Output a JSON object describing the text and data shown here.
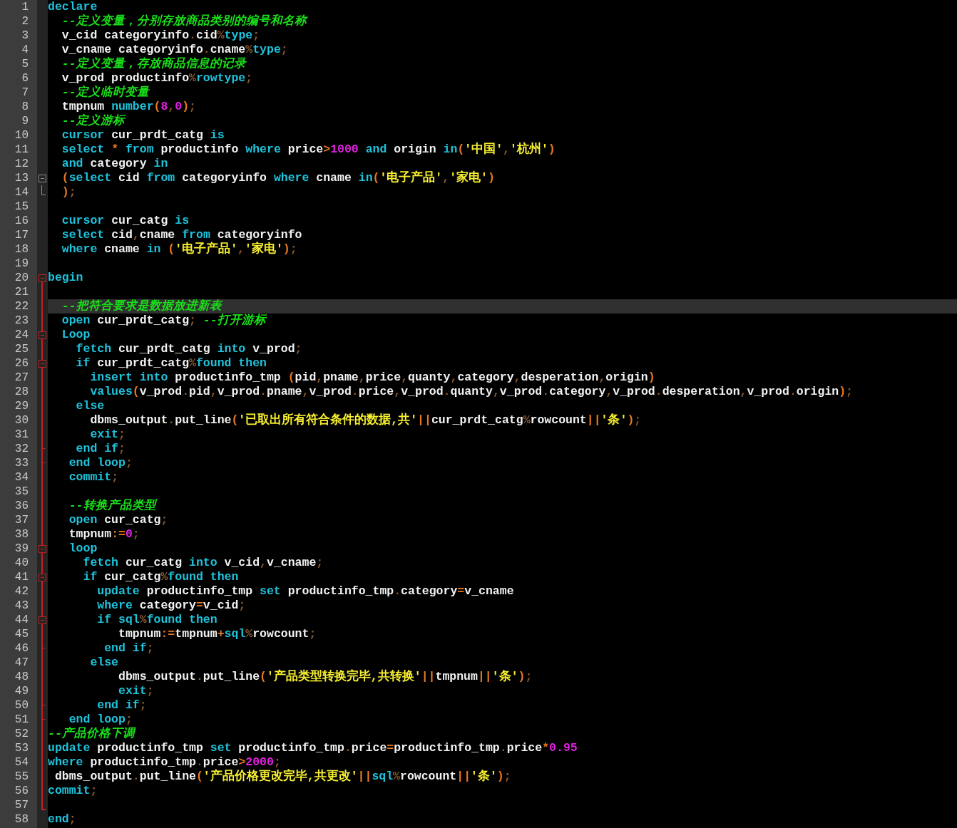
{
  "editor": {
    "lines": [
      {
        "number": "1",
        "selected": false,
        "tokens": [
          {
            "kind": "kw",
            "text": "declare"
          }
        ]
      },
      {
        "number": "2",
        "selected": false,
        "tokens": [
          {
            "kind": "cm",
            "text": "  --定义变量，分别存放商品类别的编号和名称"
          }
        ]
      },
      {
        "number": "3",
        "selected": false,
        "tokens": [
          {
            "kind": "id",
            "text": "  v_cid categoryinfo"
          },
          {
            "kind": "pu",
            "text": "."
          },
          {
            "kind": "id",
            "text": "cid"
          },
          {
            "kind": "pu",
            "text": "%"
          },
          {
            "kind": "kw",
            "text": "type"
          },
          {
            "kind": "pu",
            "text": ";"
          }
        ]
      },
      {
        "number": "4",
        "selected": false,
        "tokens": [
          {
            "kind": "id",
            "text": "  v_cname categoryinfo"
          },
          {
            "kind": "pu",
            "text": "."
          },
          {
            "kind": "id",
            "text": "cname"
          },
          {
            "kind": "pu",
            "text": "%"
          },
          {
            "kind": "kw",
            "text": "type"
          },
          {
            "kind": "pu",
            "text": ";"
          }
        ]
      },
      {
        "number": "5",
        "selected": false,
        "tokens": [
          {
            "kind": "cm",
            "text": "  --定义变量，存放商品信息的记录"
          }
        ]
      },
      {
        "number": "6",
        "selected": false,
        "tokens": [
          {
            "kind": "id",
            "text": "  v_prod productinfo"
          },
          {
            "kind": "pu",
            "text": "%"
          },
          {
            "kind": "kw",
            "text": "rowtype"
          },
          {
            "kind": "pu",
            "text": ";"
          }
        ]
      },
      {
        "number": "7",
        "selected": false,
        "tokens": [
          {
            "kind": "cm",
            "text": "  --定义临时变量"
          }
        ]
      },
      {
        "number": "8",
        "selected": false,
        "tokens": [
          {
            "kind": "id",
            "text": "  tmpnum "
          },
          {
            "kind": "kw",
            "text": "number"
          },
          {
            "kind": "op",
            "text": "("
          },
          {
            "kind": "num",
            "text": "8"
          },
          {
            "kind": "pu",
            "text": ","
          },
          {
            "kind": "num",
            "text": "0"
          },
          {
            "kind": "op",
            "text": ")"
          },
          {
            "kind": "pu",
            "text": ";"
          }
        ]
      },
      {
        "number": "9",
        "selected": false,
        "tokens": [
          {
            "kind": "cm",
            "text": "  --定义游标"
          }
        ]
      },
      {
        "number": "10",
        "selected": false,
        "tokens": [
          {
            "kind": "kw",
            "text": "  cursor "
          },
          {
            "kind": "id",
            "text": "cur_prdt_catg "
          },
          {
            "kind": "kw",
            "text": "is"
          }
        ]
      },
      {
        "number": "11",
        "selected": false,
        "tokens": [
          {
            "kind": "kw",
            "text": "  select "
          },
          {
            "kind": "op",
            "text": "* "
          },
          {
            "kind": "kw",
            "text": "from "
          },
          {
            "kind": "id",
            "text": "productinfo "
          },
          {
            "kind": "kw",
            "text": "where "
          },
          {
            "kind": "id",
            "text": "price"
          },
          {
            "kind": "op",
            "text": ">"
          },
          {
            "kind": "num",
            "text": "1000 "
          },
          {
            "kind": "kw",
            "text": "and "
          },
          {
            "kind": "id",
            "text": "origin "
          },
          {
            "kind": "kw",
            "text": "in"
          },
          {
            "kind": "op",
            "text": "("
          },
          {
            "kind": "str",
            "text": "'中国'"
          },
          {
            "kind": "pu",
            "text": ","
          },
          {
            "kind": "str",
            "text": "'杭州'"
          },
          {
            "kind": "op",
            "text": ")"
          }
        ]
      },
      {
        "number": "12",
        "selected": false,
        "tokens": [
          {
            "kind": "kw",
            "text": "  and "
          },
          {
            "kind": "id",
            "text": "category "
          },
          {
            "kind": "kw",
            "text": "in"
          }
        ]
      },
      {
        "number": "13",
        "selected": false,
        "kind": "open",
        "tokens": [
          {
            "kind": "op",
            "text": "  ("
          },
          {
            "kind": "kw",
            "text": "select "
          },
          {
            "kind": "id",
            "text": "cid "
          },
          {
            "kind": "kw",
            "text": "from "
          },
          {
            "kind": "id",
            "text": "categoryinfo "
          },
          {
            "kind": "kw",
            "text": "where "
          },
          {
            "kind": "id",
            "text": "cname "
          },
          {
            "kind": "kw",
            "text": "in"
          },
          {
            "kind": "op",
            "text": "("
          },
          {
            "kind": "str",
            "text": "'电子产品'"
          },
          {
            "kind": "pu",
            "text": ","
          },
          {
            "kind": "str",
            "text": "'家电'"
          },
          {
            "kind": "op",
            "text": ")"
          }
        ]
      },
      {
        "number": "14",
        "selected": false,
        "kind": "close",
        "tokens": [
          {
            "kind": "op",
            "text": "  )"
          },
          {
            "kind": "pu",
            "text": ";"
          }
        ]
      },
      {
        "number": "15",
        "selected": false
      },
      {
        "number": "16",
        "selected": false,
        "tokens": [
          {
            "kind": "kw",
            "text": "  cursor "
          },
          {
            "kind": "id",
            "text": "cur_catg "
          },
          {
            "kind": "kw",
            "text": "is"
          }
        ]
      },
      {
        "number": "17",
        "selected": false,
        "tokens": [
          {
            "kind": "kw",
            "text": "  select "
          },
          {
            "kind": "id",
            "text": "cid"
          },
          {
            "kind": "pu",
            "text": ","
          },
          {
            "kind": "id",
            "text": "cname "
          },
          {
            "kind": "kw",
            "text": "from "
          },
          {
            "kind": "id",
            "text": "categoryinfo"
          }
        ]
      },
      {
        "number": "18",
        "selected": false,
        "tokens": [
          {
            "kind": "kw",
            "text": "  where "
          },
          {
            "kind": "id",
            "text": "cname "
          },
          {
            "kind": "kw",
            "text": "in "
          },
          {
            "kind": "op",
            "text": "("
          },
          {
            "kind": "str",
            "text": "'电子产品'"
          },
          {
            "kind": "pu",
            "text": ","
          },
          {
            "kind": "str",
            "text": "'家电'"
          },
          {
            "kind": "op",
            "text": ")"
          },
          {
            "kind": "pu",
            "text": ";"
          }
        ]
      },
      {
        "number": "19",
        "selected": false
      },
      {
        "number": "20",
        "selected": false,
        "kind": "block-open",
        "tokens": [
          {
            "kind": "kw",
            "text": "begin"
          }
        ]
      },
      {
        "number": "21",
        "selected": false
      },
      {
        "number": "22",
        "selected": true,
        "tokens": [
          {
            "kind": "cm",
            "text": "  --把符合要求是数据放进新表"
          }
        ]
      },
      {
        "number": "23",
        "selected": false,
        "tokens": [
          {
            "kind": "kw",
            "text": "  open "
          },
          {
            "kind": "id",
            "text": "cur_prdt_catg"
          },
          {
            "kind": "pu",
            "text": "; "
          },
          {
            "kind": "cm",
            "text": "--打开游标"
          }
        ]
      },
      {
        "number": "24",
        "selected": false,
        "kind": "sub-open",
        "tokens": [
          {
            "kind": "kw",
            "text": "  Loop"
          }
        ]
      },
      {
        "number": "25",
        "selected": false,
        "tokens": [
          {
            "kind": "kw",
            "text": "    fetch "
          },
          {
            "kind": "id",
            "text": "cur_prdt_catg "
          },
          {
            "kind": "kw",
            "text": "into "
          },
          {
            "kind": "id",
            "text": "v_prod"
          },
          {
            "kind": "pu",
            "text": ";"
          }
        ]
      },
      {
        "number": "26",
        "selected": false,
        "kind": "sub-open",
        "tokens": [
          {
            "kind": "kw",
            "text": "    if "
          },
          {
            "kind": "id",
            "text": "cur_prdt_catg"
          },
          {
            "kind": "pu",
            "text": "%"
          },
          {
            "kind": "kw",
            "text": "found then"
          }
        ]
      },
      {
        "number": "27",
        "selected": false,
        "tokens": [
          {
            "kind": "kw",
            "text": "      insert into "
          },
          {
            "kind": "id",
            "text": "productinfo_tmp "
          },
          {
            "kind": "op",
            "text": "("
          },
          {
            "kind": "id",
            "text": "pid"
          },
          {
            "kind": "pu",
            "text": ","
          },
          {
            "kind": "id",
            "text": "pname"
          },
          {
            "kind": "pu",
            "text": ","
          },
          {
            "kind": "id",
            "text": "price"
          },
          {
            "kind": "pu",
            "text": ","
          },
          {
            "kind": "id",
            "text": "quanty"
          },
          {
            "kind": "pu",
            "text": ","
          },
          {
            "kind": "id",
            "text": "category"
          },
          {
            "kind": "pu",
            "text": ","
          },
          {
            "kind": "id",
            "text": "desperation"
          },
          {
            "kind": "pu",
            "text": ","
          },
          {
            "kind": "id",
            "text": "origin"
          },
          {
            "kind": "op",
            "text": ")"
          }
        ]
      },
      {
        "number": "28",
        "selected": false,
        "tokens": [
          {
            "kind": "kw",
            "text": "      values"
          },
          {
            "kind": "op",
            "text": "("
          },
          {
            "kind": "id",
            "text": "v_prod"
          },
          {
            "kind": "pu",
            "text": "."
          },
          {
            "kind": "id",
            "text": "pid"
          },
          {
            "kind": "pu",
            "text": ","
          },
          {
            "kind": "id",
            "text": "v_prod"
          },
          {
            "kind": "pu",
            "text": "."
          },
          {
            "kind": "id",
            "text": "pname"
          },
          {
            "kind": "pu",
            "text": ","
          },
          {
            "kind": "id",
            "text": "v_prod"
          },
          {
            "kind": "pu",
            "text": "."
          },
          {
            "kind": "id",
            "text": "price"
          },
          {
            "kind": "pu",
            "text": ","
          },
          {
            "kind": "id",
            "text": "v_prod"
          },
          {
            "kind": "pu",
            "text": "."
          },
          {
            "kind": "id",
            "text": "quanty"
          },
          {
            "kind": "pu",
            "text": ","
          },
          {
            "kind": "id",
            "text": "v_prod"
          },
          {
            "kind": "pu",
            "text": "."
          },
          {
            "kind": "id",
            "text": "category"
          },
          {
            "kind": "pu",
            "text": ","
          },
          {
            "kind": "id",
            "text": "v_prod"
          },
          {
            "kind": "pu",
            "text": "."
          },
          {
            "kind": "id",
            "text": "desperation"
          },
          {
            "kind": "pu",
            "text": ","
          },
          {
            "kind": "id",
            "text": "v_prod"
          },
          {
            "kind": "pu",
            "text": "."
          },
          {
            "kind": "id",
            "text": "origin"
          },
          {
            "kind": "op",
            "text": ")"
          },
          {
            "kind": "pu",
            "text": ";"
          }
        ]
      },
      {
        "number": "29",
        "selected": false,
        "tokens": [
          {
            "kind": "kw",
            "text": "    else"
          }
        ]
      },
      {
        "number": "30",
        "selected": false,
        "tokens": [
          {
            "kind": "id",
            "text": "      dbms_output"
          },
          {
            "kind": "pu",
            "text": "."
          },
          {
            "kind": "id",
            "text": "put_line"
          },
          {
            "kind": "op",
            "text": "("
          },
          {
            "kind": "str",
            "text": "'已取出所有符合条件的数据,共'"
          },
          {
            "kind": "op",
            "text": "||"
          },
          {
            "kind": "id",
            "text": "cur_prdt_catg"
          },
          {
            "kind": "pu",
            "text": "%"
          },
          {
            "kind": "id",
            "text": "rowcount"
          },
          {
            "kind": "op",
            "text": "||"
          },
          {
            "kind": "str",
            "text": "'条'"
          },
          {
            "kind": "op",
            "text": ")"
          },
          {
            "kind": "pu",
            "text": ";"
          }
        ]
      },
      {
        "number": "31",
        "selected": false,
        "tokens": [
          {
            "kind": "kw",
            "text": "      exit"
          },
          {
            "kind": "pu",
            "text": ";"
          }
        ]
      },
      {
        "number": "32",
        "selected": false,
        "kind": "sub-close",
        "tokens": [
          {
            "kind": "kw",
            "text": "    end if"
          },
          {
            "kind": "pu",
            "text": ";"
          }
        ]
      },
      {
        "number": "33",
        "selected": false,
        "kind": "sub-close",
        "tokens": [
          {
            "kind": "kw",
            "text": "   end loop"
          },
          {
            "kind": "pu",
            "text": ";"
          }
        ]
      },
      {
        "number": "34",
        "selected": false,
        "tokens": [
          {
            "kind": "kw",
            "text": "   commit"
          },
          {
            "kind": "pu",
            "text": ";"
          }
        ]
      },
      {
        "number": "35",
        "selected": false
      },
      {
        "number": "36",
        "selected": false,
        "tokens": [
          {
            "kind": "cm",
            "text": "   --转换产品类型"
          }
        ]
      },
      {
        "number": "37",
        "selected": false,
        "tokens": [
          {
            "kind": "kw",
            "text": "   open "
          },
          {
            "kind": "id",
            "text": "cur_catg"
          },
          {
            "kind": "pu",
            "text": ";"
          }
        ]
      },
      {
        "number": "38",
        "selected": false,
        "tokens": [
          {
            "kind": "id",
            "text": "   tmpnum"
          },
          {
            "kind": "op",
            "text": ":="
          },
          {
            "kind": "num",
            "text": "0"
          },
          {
            "kind": "pu",
            "text": ";"
          }
        ]
      },
      {
        "number": "39",
        "selected": false,
        "kind": "sub-open",
        "tokens": [
          {
            "kind": "kw",
            "text": "   loop"
          }
        ]
      },
      {
        "number": "40",
        "selected": false,
        "tokens": [
          {
            "kind": "kw",
            "text": "     fetch "
          },
          {
            "kind": "id",
            "text": "cur_catg "
          },
          {
            "kind": "kw",
            "text": "into "
          },
          {
            "kind": "id",
            "text": "v_cid"
          },
          {
            "kind": "pu",
            "text": ","
          },
          {
            "kind": "id",
            "text": "v_cname"
          },
          {
            "kind": "pu",
            "text": ";"
          }
        ]
      },
      {
        "number": "41",
        "selected": false,
        "kind": "sub-open",
        "tokens": [
          {
            "kind": "kw",
            "text": "     if "
          },
          {
            "kind": "id",
            "text": "cur_catg"
          },
          {
            "kind": "pu",
            "text": "%"
          },
          {
            "kind": "kw",
            "text": "found then"
          }
        ]
      },
      {
        "number": "42",
        "selected": false,
        "tokens": [
          {
            "kind": "kw",
            "text": "       update "
          },
          {
            "kind": "id",
            "text": "productinfo_tmp "
          },
          {
            "kind": "kw",
            "text": "set "
          },
          {
            "kind": "id",
            "text": "productinfo_tmp"
          },
          {
            "kind": "pu",
            "text": "."
          },
          {
            "kind": "id",
            "text": "category"
          },
          {
            "kind": "op",
            "text": "="
          },
          {
            "kind": "id",
            "text": "v_cname"
          }
        ]
      },
      {
        "number": "43",
        "selected": false,
        "tokens": [
          {
            "kind": "kw",
            "text": "       where "
          },
          {
            "kind": "id",
            "text": "category"
          },
          {
            "kind": "op",
            "text": "="
          },
          {
            "kind": "id",
            "text": "v_cid"
          },
          {
            "kind": "pu",
            "text": ";"
          }
        ]
      },
      {
        "number": "44",
        "selected": false,
        "kind": "sub-open",
        "tokens": [
          {
            "kind": "kw",
            "text": "       if sql"
          },
          {
            "kind": "pu",
            "text": "%"
          },
          {
            "kind": "kw",
            "text": "found then"
          }
        ]
      },
      {
        "number": "45",
        "selected": false,
        "tokens": [
          {
            "kind": "id",
            "text": "          tmpnum"
          },
          {
            "kind": "op",
            "text": ":="
          },
          {
            "kind": "id",
            "text": "tmpnum"
          },
          {
            "kind": "op",
            "text": "+"
          },
          {
            "kind": "kw",
            "text": "sql"
          },
          {
            "kind": "pu",
            "text": "%"
          },
          {
            "kind": "id",
            "text": "rowcount"
          },
          {
            "kind": "pu",
            "text": ";"
          }
        ]
      },
      {
        "number": "46",
        "selected": false,
        "kind": "sub-close",
        "tokens": [
          {
            "kind": "kw",
            "text": "        end if"
          },
          {
            "kind": "pu",
            "text": ";"
          }
        ]
      },
      {
        "number": "47",
        "selected": false,
        "tokens": [
          {
            "kind": "kw",
            "text": "      else"
          }
        ]
      },
      {
        "number": "48",
        "selected": false,
        "tokens": [
          {
            "kind": "id",
            "text": "          dbms_output"
          },
          {
            "kind": "pu",
            "text": "."
          },
          {
            "kind": "id",
            "text": "put_line"
          },
          {
            "kind": "op",
            "text": "("
          },
          {
            "kind": "str",
            "text": "'产品类型转换完毕,共转换'"
          },
          {
            "kind": "op",
            "text": "||"
          },
          {
            "kind": "id",
            "text": "tmpnum"
          },
          {
            "kind": "op",
            "text": "||"
          },
          {
            "kind": "str",
            "text": "'条'"
          },
          {
            "kind": "op",
            "text": ")"
          },
          {
            "kind": "pu",
            "text": ";"
          }
        ]
      },
      {
        "number": "49",
        "selected": false,
        "tokens": [
          {
            "kind": "kw",
            "text": "          exit"
          },
          {
            "kind": "pu",
            "text": ";"
          }
        ]
      },
      {
        "number": "50",
        "selected": false,
        "kind": "sub-close",
        "tokens": [
          {
            "kind": "kw",
            "text": "       end if"
          },
          {
            "kind": "pu",
            "text": ";"
          }
        ]
      },
      {
        "number": "51",
        "selected": false,
        "kind": "sub-close",
        "tokens": [
          {
            "kind": "kw",
            "text": "   end loop"
          },
          {
            "kind": "pu",
            "text": ";"
          }
        ]
      },
      {
        "number": "52",
        "selected": false,
        "tokens": [
          {
            "kind": "cm",
            "text": "--产品价格下调"
          }
        ]
      },
      {
        "number": "53",
        "selected": false,
        "tokens": [
          {
            "kind": "kw",
            "text": "update "
          },
          {
            "kind": "id",
            "text": "productinfo_tmp "
          },
          {
            "kind": "kw",
            "text": "set "
          },
          {
            "kind": "id",
            "text": "productinfo_tmp"
          },
          {
            "kind": "pu",
            "text": "."
          },
          {
            "kind": "id",
            "text": "price"
          },
          {
            "kind": "op",
            "text": "="
          },
          {
            "kind": "id",
            "text": "productinfo_tmp"
          },
          {
            "kind": "pu",
            "text": "."
          },
          {
            "kind": "id",
            "text": "price"
          },
          {
            "kind": "op",
            "text": "*"
          },
          {
            "kind": "num",
            "text": "0.95"
          }
        ]
      },
      {
        "number": "54",
        "selected": false,
        "tokens": [
          {
            "kind": "kw",
            "text": "where "
          },
          {
            "kind": "id",
            "text": "productinfo_tmp"
          },
          {
            "kind": "pu",
            "text": "."
          },
          {
            "kind": "id",
            "text": "price"
          },
          {
            "kind": "op",
            "text": ">"
          },
          {
            "kind": "num",
            "text": "2000"
          },
          {
            "kind": "pu",
            "text": ";"
          }
        ]
      },
      {
        "number": "55",
        "selected": false,
        "tokens": [
          {
            "kind": "id",
            "text": " dbms_output"
          },
          {
            "kind": "pu",
            "text": "."
          },
          {
            "kind": "id",
            "text": "put_line"
          },
          {
            "kind": "op",
            "text": "("
          },
          {
            "kind": "str",
            "text": "'产品价格更改完毕,共更改'"
          },
          {
            "kind": "op",
            "text": "||"
          },
          {
            "kind": "kw",
            "text": "sql"
          },
          {
            "kind": "pu",
            "text": "%"
          },
          {
            "kind": "id",
            "text": "rowcount"
          },
          {
            "kind": "op",
            "text": "||"
          },
          {
            "kind": "str",
            "text": "'条'"
          },
          {
            "kind": "op",
            "text": ")"
          },
          {
            "kind": "pu",
            "text": ";"
          }
        ]
      },
      {
        "number": "56",
        "selected": false,
        "tokens": [
          {
            "kind": "kw",
            "text": "commit"
          },
          {
            "kind": "pu",
            "text": ";"
          }
        ]
      },
      {
        "number": "57",
        "selected": false,
        "kind": "block-end"
      },
      {
        "number": "58",
        "selected": false,
        "tokens": [
          {
            "kind": "kw",
            "text": "end"
          },
          {
            "kind": "pu",
            "text": ";"
          }
        ]
      }
    ]
  }
}
